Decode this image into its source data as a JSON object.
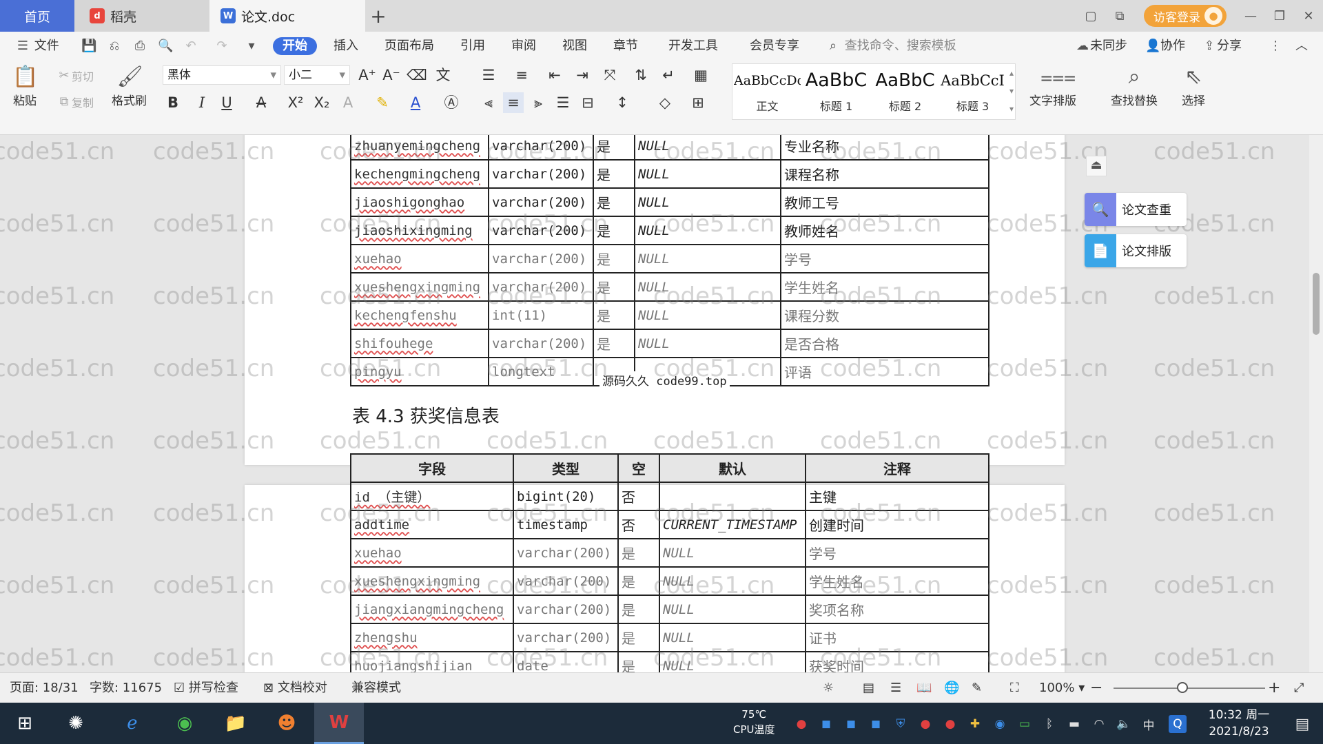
{
  "tabs": {
    "home": "首页",
    "docer": "稻壳",
    "document": "论文.doc",
    "new_tab": "+"
  },
  "window": {
    "visitor_login": "访客登录"
  },
  "menu": {
    "file": "文件",
    "start": "开始",
    "insert": "插入",
    "layout": "页面布局",
    "reference": "引用",
    "review": "审阅",
    "view": "视图",
    "section": "章节",
    "devtools": "开发工具",
    "member": "会员专享",
    "search_placeholder": "查找命令、搜索模板",
    "unsynced": "未同步",
    "collab": "协作",
    "share": "分享"
  },
  "toolbar": {
    "paste": "粘贴",
    "cut": "剪切",
    "copy": "复制",
    "format_painter": "格式刷",
    "font_name": "黑体",
    "font_size": "小二",
    "text_layout": "文字排版",
    "find_replace": "查找替换",
    "select": "选择"
  },
  "styles": [
    {
      "preview": "AaBbCcDd",
      "label": "正文"
    },
    {
      "preview": "AaBbC",
      "label": "标题 1"
    },
    {
      "preview": "AaBbC",
      "label": "标题 2"
    },
    {
      "preview": "AaBbCcI",
      "label": "标题 3"
    }
  ],
  "table_top": {
    "rows": [
      [
        "zhuanyemingcheng",
        "varchar(200)",
        "是",
        "NULL",
        "专业名称"
      ],
      [
        "kechengmingcheng",
        "varchar(200)",
        "是",
        "NULL",
        "课程名称"
      ],
      [
        "jiaoshigonghao",
        "varchar(200)",
        "是",
        "NULL",
        "教师工号"
      ],
      [
        "jiaoshixingming",
        "varchar(200)",
        "是",
        "NULL",
        "教师姓名"
      ],
      [
        "xuehao",
        "varchar(200)",
        "是",
        "NULL",
        "学号"
      ],
      [
        "xueshengxingming",
        "varchar(200)",
        "是",
        "NULL",
        "学生姓名"
      ],
      [
        "kechengfenshu",
        "int(11)",
        "是",
        "NULL",
        "课程分数"
      ],
      [
        "shifouhege",
        "varchar(200)",
        "是",
        "NULL",
        "是否合格"
      ],
      [
        "pingyu",
        "longtext",
        "",
        "",
        "评语"
      ]
    ],
    "overlay": "源码久久 code99.top"
  },
  "caption": "表 4.3  获奖信息表",
  "table_bottom": {
    "headers": [
      "字段",
      "类型",
      "空",
      "默认",
      "注释"
    ],
    "rows": [
      [
        "id （主键）",
        "bigint(20)",
        "否",
        "",
        "主键"
      ],
      [
        "addtime",
        "timestamp",
        "否",
        "CURRENT_TIMESTAMP",
        "创建时间"
      ],
      [
        "xuehao",
        "varchar(200)",
        "是",
        "NULL",
        "学号"
      ],
      [
        "xueshengxingming",
        "varchar(200)",
        "是",
        "NULL",
        "学生姓名"
      ],
      [
        "jiangxiangmingcheng",
        "varchar(200)",
        "是",
        "NULL",
        "奖项名称"
      ],
      [
        "zhengshu",
        "varchar(200)",
        "是",
        "NULL",
        "证书"
      ],
      [
        "huojiangshijian",
        "date",
        "是",
        "NULL",
        "获奖时间"
      ]
    ]
  },
  "side_panel": {
    "check": "论文查重",
    "format": "论文排版"
  },
  "watermark": "code51.cn",
  "status": {
    "page": "页面: 18/31",
    "words": "字数: 11675",
    "spell": "拼写检查",
    "proof": "文档校对",
    "compat": "兼容模式",
    "zoom": "100%"
  },
  "taskbar": {
    "cpu_temp": "75℃",
    "cpu_label": "CPU温度",
    "ime": "中",
    "time": "10:32 周一",
    "date": "2021/8/23"
  },
  "colors": {
    "accent": "#3c6fe0",
    "visitor": "#f2a33a",
    "taskbar": "#1c2b3a"
  }
}
